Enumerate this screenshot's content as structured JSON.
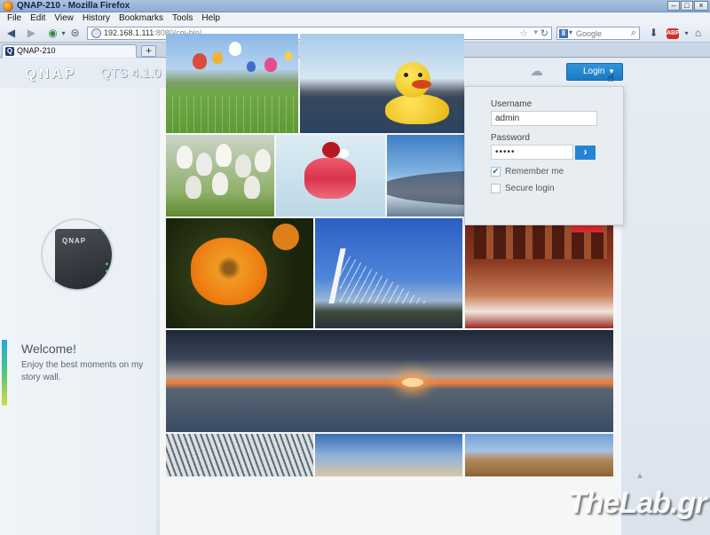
{
  "window": {
    "title": "QNAP-210 - Mozilla Firefox",
    "buttons": {
      "minimize": "–",
      "maximize": "□",
      "close": "×"
    }
  },
  "menu": [
    "File",
    "Edit",
    "View",
    "History",
    "Bookmarks",
    "Tools",
    "Help"
  ],
  "address": {
    "host": "192.168.1.111",
    "rest": ":8080/cgi-bin/",
    "search_engine_icon": "8",
    "search_placeholder": "Google",
    "adblock": "ABP"
  },
  "tabs": [
    {
      "label": "QNAP-210"
    }
  ],
  "new_tab": "+",
  "qnap": {
    "logo": "QNAP",
    "version": "QTS 4.1.0",
    "login_button": "Login",
    "device_brand": "QNAP",
    "welcome_title": "Welcome!",
    "welcome_text": "Enjoy the best moments on my story wall."
  },
  "login_form": {
    "username_label": "Username",
    "username_value": "admin",
    "password_label": "Password",
    "password_value": "•••••",
    "remember_label": "Remember me",
    "remember_checked": true,
    "secure_label": "Secure login",
    "secure_checked": false,
    "submit_glyph": "›"
  },
  "watermark": "TheLab.gr",
  "icons": {
    "back": "back-arrow-icon",
    "forward": "forward-arrow-icon",
    "home": "home-icon",
    "download": "download-icon",
    "cloud": "cloud-icon",
    "reload": "reload-icon",
    "star": "bookmark-star-icon"
  }
}
